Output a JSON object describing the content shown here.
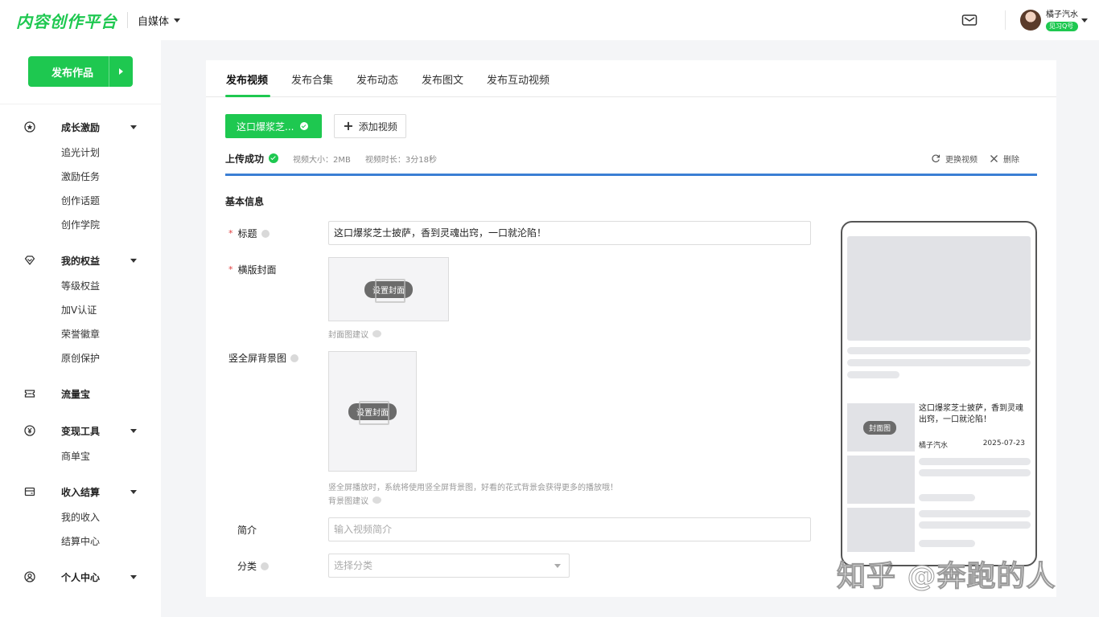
{
  "header": {
    "logo": "内容创作平台",
    "media_type": "自媒体",
    "user_name": "橘子汽水",
    "user_badge": "见习Q号"
  },
  "sidebar": {
    "publish_label": "发布作品",
    "groups": [
      {
        "label": "成长激励",
        "icon": "star-badge-icon",
        "items": [
          "追光计划",
          "激励任务",
          "创作话题",
          "创作学院"
        ]
      },
      {
        "label": "我的权益",
        "icon": "diamond-icon",
        "items": [
          "等级权益",
          "加V认证",
          "荣誉徽章",
          "原创保护"
        ]
      },
      {
        "label": "流量宝",
        "icon": "ticket-icon",
        "items": []
      },
      {
        "label": "变现工具",
        "icon": "yen-icon",
        "items": [
          "商单宝"
        ]
      },
      {
        "label": "收入结算",
        "icon": "wallet-icon",
        "items": [
          "我的收入",
          "结算中心"
        ]
      },
      {
        "label": "个人中心",
        "icon": "user-icon",
        "items": []
      }
    ]
  },
  "tabs": [
    "发布视频",
    "发布合集",
    "发布动态",
    "发布图文",
    "发布互动视频"
  ],
  "upload": {
    "chip_label": "这口爆浆芝...",
    "add_video": "添加视频",
    "status": "上传成功",
    "size": "视频大小：2MB",
    "duration": "视频时长：3分18秒",
    "replace": "更换视频",
    "delete": "删除",
    "progress": 1.0
  },
  "form": {
    "section": "基本信息",
    "title_label": "标题",
    "title_value": "这口爆浆芝士披萨，香到灵魂出窍，一口就沦陷！",
    "cover_label": "横版封面",
    "cover_btn": "设置封面",
    "cover_hint": "封面图建议",
    "bg_label": "竖全屏背景图",
    "bg_btn": "设置封面",
    "bg_note": "竖全屏播放时，系统将使用竖全屏背景图，好看的花式背景会获得更多的播放哦！",
    "bg_hint": "背景图建议",
    "intro_label": "简介",
    "intro_placeholder": "输入视频简介",
    "category_label": "分类",
    "category_placeholder": "选择分类"
  },
  "preview": {
    "thumb_label": "封面图",
    "title": "这口爆浆芝士披萨，香到灵魂出窍，一口就沦陷！",
    "author": "橘子汽水",
    "date": "2025-07-23"
  },
  "watermark": "知乎 @奔跑的人",
  "colors": {
    "accent": "#1ec850",
    "progress": "#3b7fd4",
    "required": "#e04040"
  }
}
